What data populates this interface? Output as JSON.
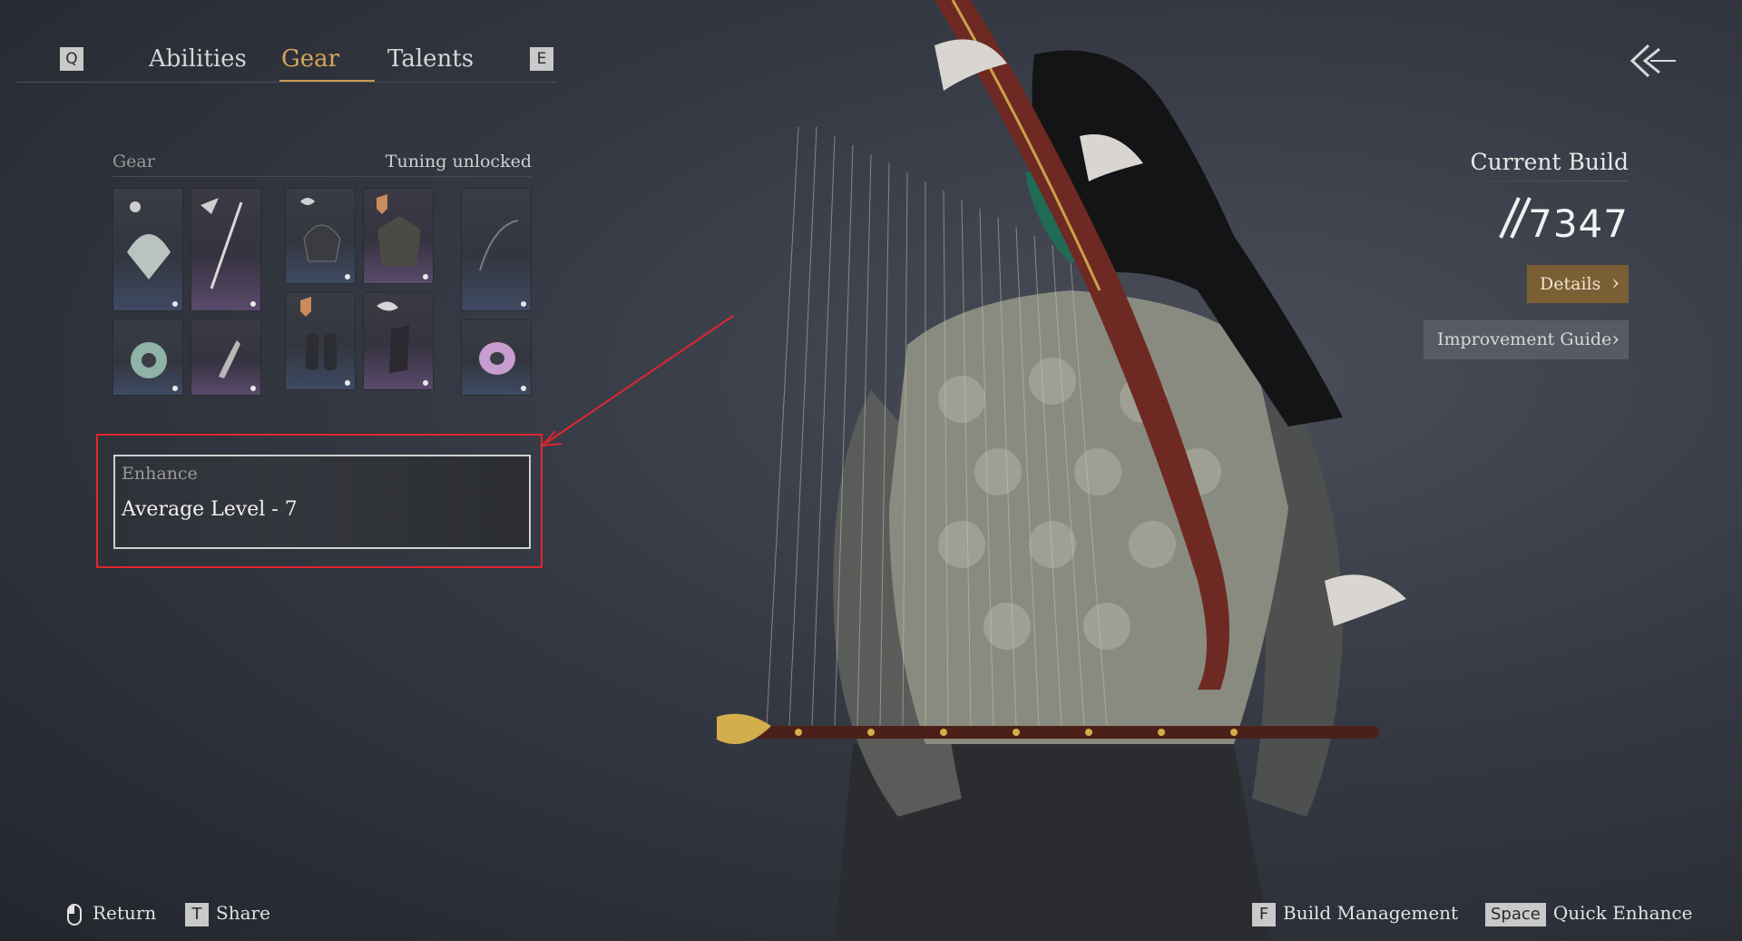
{
  "tabs": {
    "prev_key": "Q",
    "next_key": "E",
    "items": [
      {
        "label": "Abilities"
      },
      {
        "label": "Gear"
      },
      {
        "label": "Talents"
      }
    ],
    "active": "Gear"
  },
  "gear": {
    "title": "Gear",
    "status": "Tuning unlocked",
    "slots": [
      {
        "icon": "fan-weapon-icon"
      },
      {
        "icon": "sword-icon"
      },
      {
        "icon": "helmet-icon"
      },
      {
        "icon": "chest-armor-icon"
      },
      {
        "icon": "bow-icon"
      },
      {
        "icon": "jade-disc-icon"
      },
      {
        "icon": "pendant-icon"
      },
      {
        "icon": "bracers-icon"
      },
      {
        "icon": "gloves-icon"
      },
      {
        "icon": "jade-ring-icon"
      }
    ]
  },
  "enhance": {
    "label": "Enhance",
    "level_text": "Average Level - 7"
  },
  "build": {
    "title": "Current Build",
    "power": "7347",
    "details_label": "Details",
    "improvement_label": "Improvement Guide"
  },
  "footer": {
    "return_label": "Return",
    "share_key": "T",
    "share_label": "Share",
    "build_key": "F",
    "build_label": "Build Management",
    "enhance_key": "Space",
    "enhance_label": "Quick Enhance"
  },
  "colors": {
    "accent_gold": "#d6a65c",
    "highlight_red": "#e0262f",
    "details_button": "#7a5f35"
  }
}
